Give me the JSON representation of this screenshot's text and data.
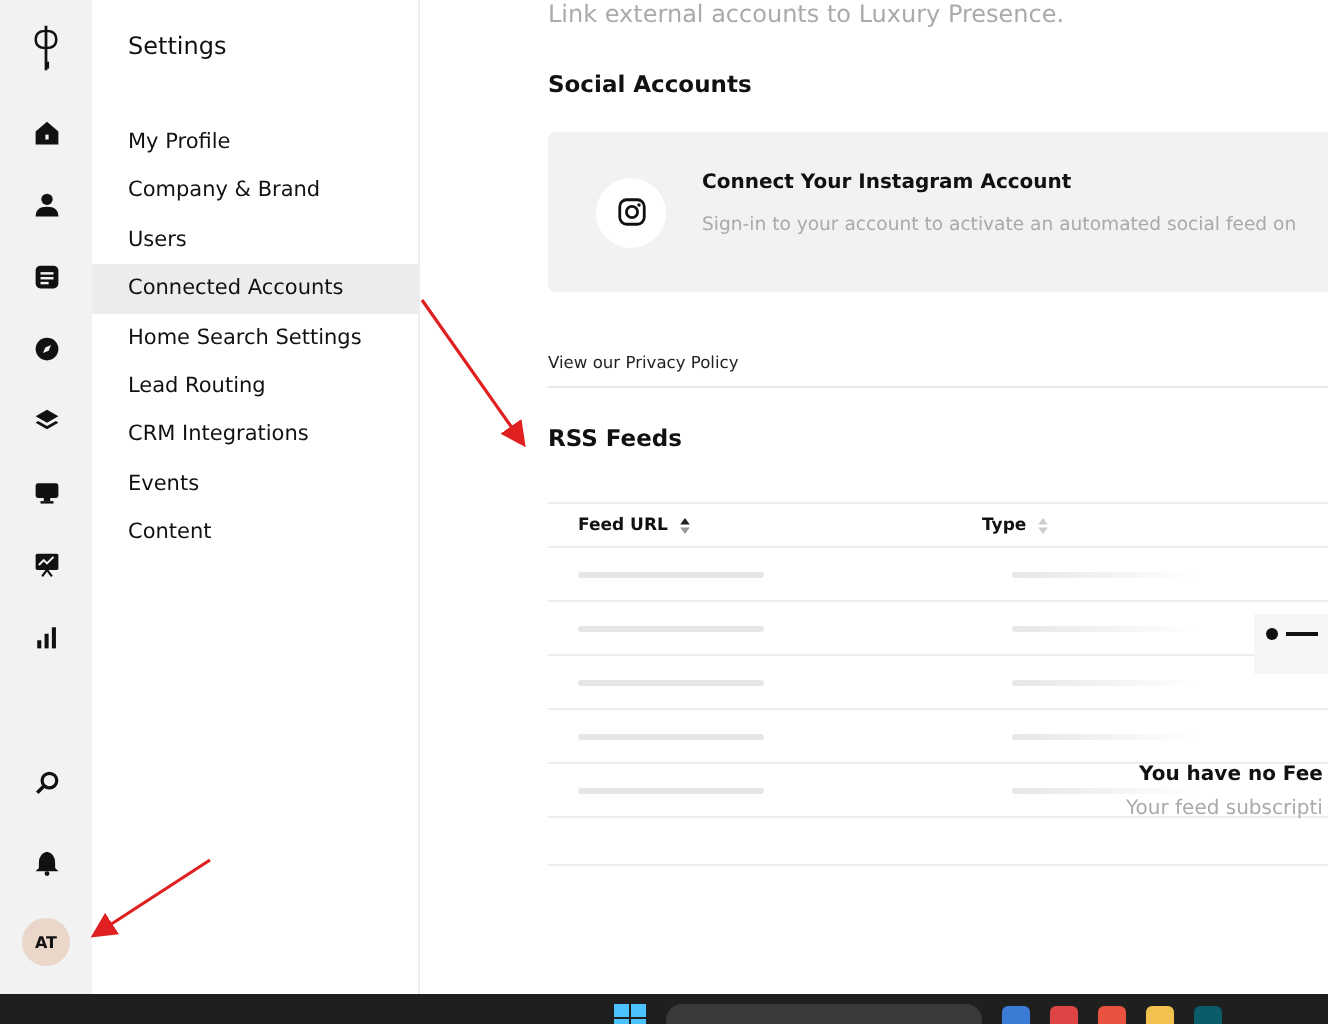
{
  "rail": {
    "items": [
      {
        "kind": "home",
        "selected": false
      },
      {
        "kind": "person",
        "selected": false
      },
      {
        "kind": "document",
        "selected": false
      },
      {
        "kind": "compass",
        "selected": false
      },
      {
        "kind": "layers",
        "selected": false
      },
      {
        "kind": "monitor",
        "selected": false
      },
      {
        "kind": "presentation",
        "selected": false
      },
      {
        "kind": "bars",
        "selected": false
      }
    ],
    "bottom": [
      {
        "kind": "search"
      },
      {
        "kind": "bell"
      }
    ],
    "avatar": "AT"
  },
  "settings_nav": {
    "title": "Settings",
    "items": [
      {
        "label": "My Profile",
        "selected": false
      },
      {
        "label": "Company & Brand",
        "selected": false
      },
      {
        "label": "Users",
        "selected": false
      },
      {
        "label": "Connected Accounts",
        "selected": true
      },
      {
        "label": "Home Search Settings",
        "selected": false
      },
      {
        "label": "Lead Routing",
        "selected": false
      },
      {
        "label": "CRM Integrations",
        "selected": false
      },
      {
        "label": "Events",
        "selected": false
      },
      {
        "label": "Content",
        "selected": false
      }
    ]
  },
  "main": {
    "subtitle": "Link external accounts to Luxury Presence.",
    "social": {
      "heading": "Social Accounts",
      "card": {
        "title": "Connect Your Instagram Account",
        "description": "Sign-in to your account to activate an automated social feed on"
      }
    },
    "privacy_link": "View our Privacy Policy",
    "rss": {
      "heading": "RSS Feeds",
      "columns": [
        {
          "label": "Feed URL",
          "sorted": true
        },
        {
          "label": "Type",
          "sorted": false
        }
      ],
      "empty_title": "You have no Fee",
      "empty_text": "Your feed subscripti"
    }
  }
}
